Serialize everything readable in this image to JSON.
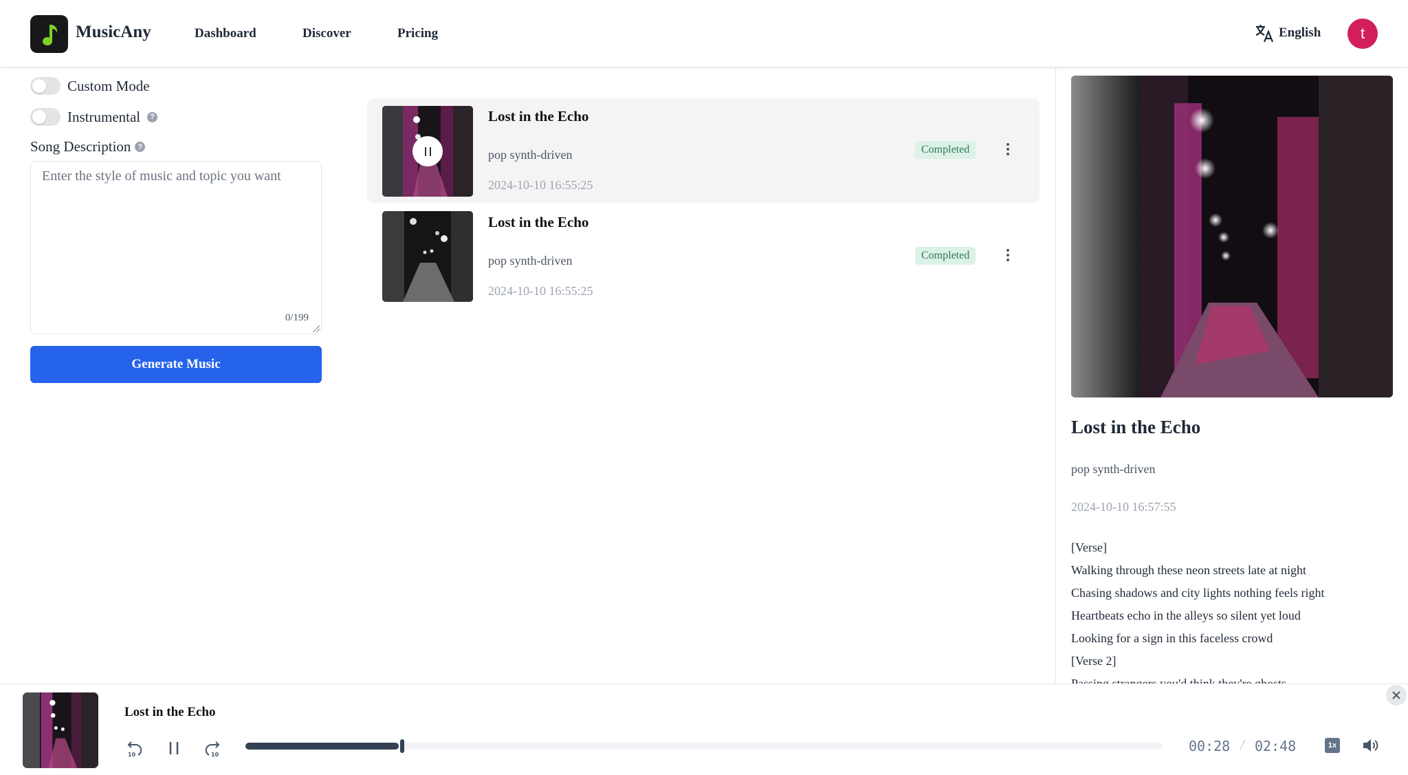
{
  "header": {
    "brand": "MusicAny",
    "nav": [
      "Dashboard",
      "Discover",
      "Pricing"
    ],
    "language": "English",
    "avatar_initial": "t",
    "avatar_color": "#d21f5a"
  },
  "form": {
    "custom_mode_label": "Custom Mode",
    "custom_mode_on": false,
    "instrumental_label": "Instrumental",
    "instrumental_on": false,
    "description_label": "Song Description",
    "description_placeholder": "Enter the style of music and topic you want",
    "description_value": "",
    "counter": "0/199",
    "generate_label": "Generate Music",
    "accent": "#2563eb"
  },
  "songs": [
    {
      "title": "Lost in the Echo",
      "style": "pop synth-driven",
      "date": "2024-10-10 16:55:25",
      "status": "Completed",
      "playing": true
    },
    {
      "title": "Lost in the Echo",
      "style": "pop synth-driven",
      "date": "2024-10-10 16:55:25",
      "status": "Completed",
      "playing": false
    }
  ],
  "detail": {
    "title": "Lost in the Echo",
    "style": "pop synth-driven",
    "date": "2024-10-10 16:57:55",
    "lyrics": [
      "[Verse]",
      "Walking through these neon streets late at night",
      "Chasing shadows and city lights nothing feels right",
      "Heartbeats echo in the alleys so silent yet loud",
      "Looking for a sign in this faceless crowd",
      "[Verse 2]",
      "Passing strangers you'd think they're ghosts"
    ]
  },
  "player": {
    "title": "Lost in the Echo",
    "current_time": "00:28",
    "separator": "/",
    "duration": "02:48",
    "progress_fraction": 0.167,
    "speed": "1x"
  }
}
